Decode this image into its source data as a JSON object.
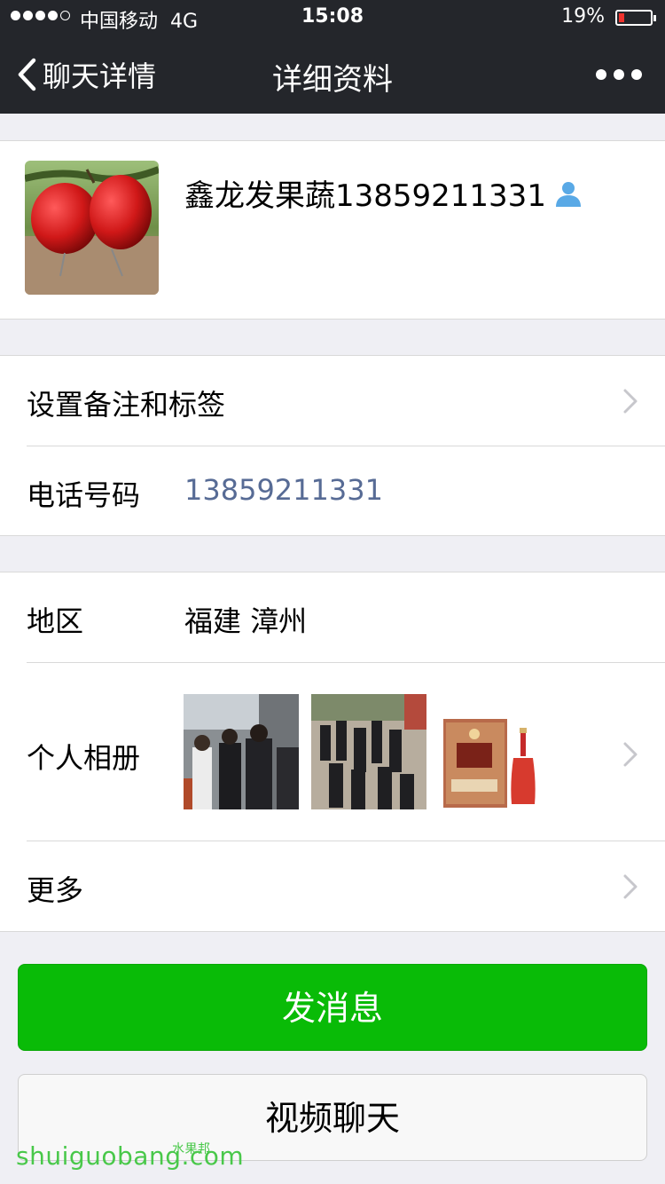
{
  "status_bar": {
    "carrier": "中国移动",
    "network": "4G",
    "time": "15:08",
    "battery_percent": "19%",
    "battery_level": 0.19,
    "signal_bars_filled": 4,
    "signal_bars_total": 5
  },
  "nav": {
    "back_label": "聊天详情",
    "title": "详细资料",
    "more_icon": "ellipsis-icon"
  },
  "profile": {
    "display_name": "鑫龙发果蔬13859211331",
    "avatar_icon": "avatar-photo",
    "badge_icon": "contact-person-icon"
  },
  "section1": {
    "remark_label": "设置备注和标签",
    "phone_label": "电话号码",
    "phone_value": "13859211331"
  },
  "section2": {
    "region_label": "地区",
    "region_value": "福建 漳州",
    "album_label": "个人相册",
    "more_label": "更多"
  },
  "actions": {
    "send_message": "发消息",
    "video_call": "视频聊天"
  },
  "watermark": {
    "text": "shuiguobang.com",
    "chinese": "水果邦"
  },
  "colors": {
    "nav_bg": "#24262b",
    "page_bg": "#efeff4",
    "primary_green": "#09bb07",
    "phone_link": "#576b95",
    "battery_low": "#f0332e"
  }
}
